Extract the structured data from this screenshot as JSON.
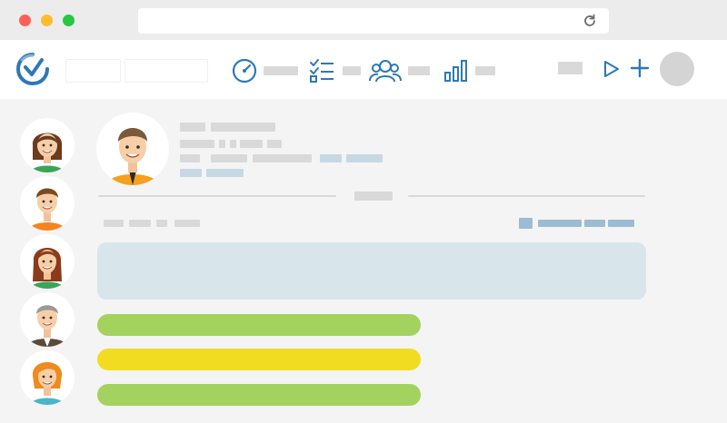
{
  "window": {
    "traffic_lights": [
      "#fe5f57",
      "#febc2e",
      "#28c840"
    ],
    "refresh_icon": "refresh-icon"
  },
  "toolbar": {
    "logo_icon": "app-logo-icon",
    "nav_items": [
      {
        "name": "dashboard",
        "icon": "speedometer-icon"
      },
      {
        "name": "tasks",
        "icon": "checklist-icon"
      },
      {
        "name": "people",
        "icon": "people-icon"
      },
      {
        "name": "reports",
        "icon": "bar-chart-icon"
      }
    ],
    "actions": [
      "play-icon",
      "plus-icon"
    ]
  },
  "colors": {
    "accent": "#2e78b7",
    "placeholder": "#d9d9d9",
    "highlight_box": "#d8e6ec",
    "pill_green": "#a4d25e",
    "pill_yellow": "#f2dc22"
  },
  "avatars": [
    {
      "person": "woman-brown-hair",
      "shirt": "#3aa457"
    },
    {
      "person": "man-orange-shirt",
      "shirt": "#f5841f"
    },
    {
      "person": "woman-long-hair",
      "shirt": "#3aa457"
    },
    {
      "person": "man-suit",
      "shirt": "#5b4a3a"
    },
    {
      "person": "woman-orange-hair",
      "shirt": "#4ab6c7"
    }
  ],
  "progress_bars": [
    {
      "color": "green",
      "fill": 0.59
    },
    {
      "color": "yellow",
      "fill": 0.59
    },
    {
      "color": "green",
      "fill": 0.59
    }
  ]
}
